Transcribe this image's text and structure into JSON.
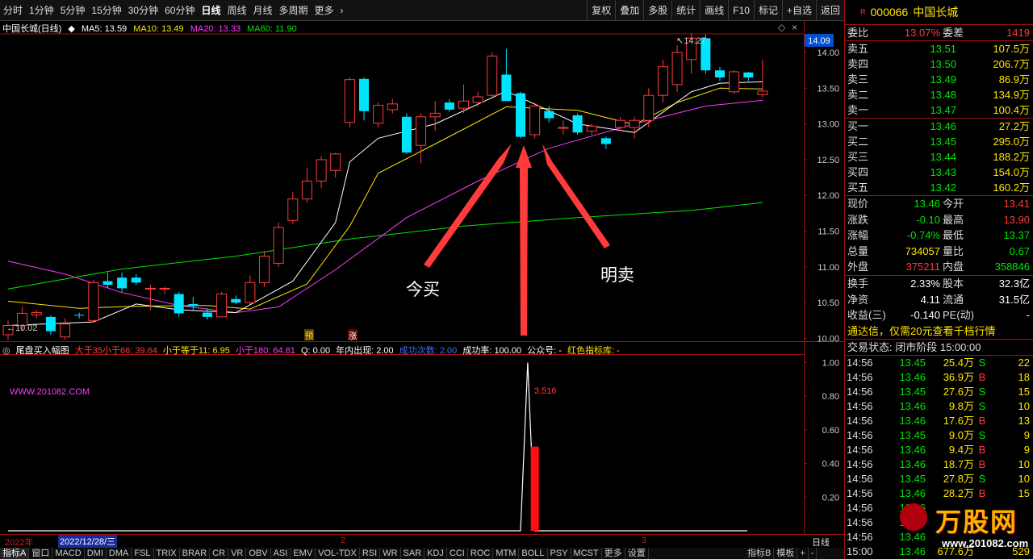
{
  "toolbar": {
    "periods": [
      "分时",
      "1分钟",
      "5分钟",
      "15分钟",
      "30分钟",
      "60分钟",
      "日线",
      "周线",
      "月线",
      "多周期",
      "更多"
    ],
    "active_period": "日线",
    "tools": [
      "复权",
      "叠加",
      "多股",
      "统计",
      "画线",
      "F10",
      "标记",
      "+自选",
      "返回"
    ]
  },
  "main_legend": {
    "name": "中国长城(日线)",
    "ma5": "MA5: 13.59",
    "ma10": "MA10: 13.49",
    "ma20": "MA20: 13.33",
    "ma60": "MA60: 11.90"
  },
  "indicator_legend": {
    "name": "尾盘买入幅图",
    "a": "大于35小于66: 39.64",
    "b": "小于等于11: 6.95",
    "c": "小于180: 64.81",
    "d": "Q: 0.00",
    "e": "年内出现: 2.00",
    "f": "成功次数: 2.00",
    "g": "成功率: 100.00",
    "h": "公众号: -",
    "i": "红色指标库: -"
  },
  "watermark_left": "WWW.201082.COM",
  "annotations": {
    "buy_text": "今买",
    "sell_text": "明卖",
    "max_label": "14.27",
    "min_label": "10.02",
    "value_label": "3.516",
    "marker1": "预",
    "marker2": "涨"
  },
  "price_axis": {
    "current": "14.09",
    "ticks": [
      "14.00",
      "13.50",
      "13.00",
      "12.50",
      "12.00",
      "11.50",
      "11.00",
      "10.50",
      "10.00"
    ]
  },
  "indicator_axis": {
    "ticks": [
      "1.00",
      "0.80",
      "0.60",
      "0.40",
      "0.20"
    ]
  },
  "time_axis": {
    "year": "2022年",
    "cursor_date": "2022/12/28/三",
    "month2": "2",
    "month3": "3",
    "period": "日线"
  },
  "bottom_tabs": [
    "指标A",
    "窗口",
    "MACD",
    "DMI",
    "DMA",
    "FSL",
    "TRIX",
    "BRAR",
    "CR",
    "VR",
    "OBV",
    "ASI",
    "EMV",
    "VOL-TDX",
    "RSI",
    "WR",
    "SAR",
    "KDJ",
    "CCI",
    "ROC",
    "MTM",
    "BOLL",
    "PSY",
    "MCST",
    "更多",
    "设置"
  ],
  "right_tabs": [
    "指标B",
    "模板",
    "+",
    "-"
  ],
  "quote": {
    "code": "000066",
    "name": "中国长城",
    "weibi_label": "委比",
    "weibi": "13.07%",
    "weicha_label": "委差",
    "weicha": "1419",
    "sell": [
      {
        "label": "卖五",
        "price": "13.51",
        "vol": "107.5万"
      },
      {
        "label": "卖四",
        "price": "13.50",
        "vol": "206.7万"
      },
      {
        "label": "卖三",
        "price": "13.49",
        "vol": "86.9万"
      },
      {
        "label": "卖二",
        "price": "13.48",
        "vol": "134.9万"
      },
      {
        "label": "卖一",
        "price": "13.47",
        "vol": "100.4万"
      }
    ],
    "buy": [
      {
        "label": "买一",
        "price": "13.46",
        "vol": "27.2万"
      },
      {
        "label": "买二",
        "price": "13.45",
        "vol": "295.0万"
      },
      {
        "label": "买三",
        "price": "13.44",
        "vol": "188.2万"
      },
      {
        "label": "买四",
        "price": "13.43",
        "vol": "154.0万"
      },
      {
        "label": "买五",
        "price": "13.42",
        "vol": "160.2万"
      }
    ],
    "stats": [
      {
        "l1": "现价",
        "v1": "13.46",
        "l2": "今开",
        "v2": "13.41",
        "c1": "dn",
        "c2": "up"
      },
      {
        "l1": "涨跌",
        "v1": "-0.10",
        "l2": "最高",
        "v2": "13.90",
        "c1": "dn",
        "c2": "up"
      },
      {
        "l1": "涨幅",
        "v1": "-0.74%",
        "l2": "最低",
        "v2": "13.37",
        "c1": "dn",
        "c2": "dn"
      },
      {
        "l1": "总量",
        "v1": "734057",
        "l2": "量比",
        "v2": "0.67",
        "c1": "yellow",
        "c2": "dn"
      },
      {
        "l1": "外盘",
        "v1": "375211",
        "l2": "内盘",
        "v2": "358846",
        "c1": "up",
        "c2": "dn"
      }
    ],
    "stats2": [
      {
        "l1": "换手",
        "v1": "2.33%",
        "l2": "股本",
        "v2": "32.3亿"
      },
      {
        "l1": "净资",
        "v1": "4.11",
        "l2": "流通",
        "v2": "31.5亿"
      },
      {
        "l1": "收益(三)",
        "v1": "-0.140",
        "l2": "PE(动)",
        "v2": "-"
      }
    ],
    "promo": "通达信，仅需20元查看千档行情",
    "trade_state": "交易状态: 闭市阶段 15:00:00",
    "ticks": [
      {
        "t": "14:56",
        "p": "13.45",
        "v": "25.4万",
        "s": "S",
        "n": "22"
      },
      {
        "t": "14:56",
        "p": "13.46",
        "v": "36.9万",
        "s": "B",
        "n": "18"
      },
      {
        "t": "14:56",
        "p": "13.45",
        "v": "27.6万",
        "s": "S",
        "n": "15"
      },
      {
        "t": "14:56",
        "p": "13.46",
        "v": "9.8万",
        "s": "S",
        "n": "10"
      },
      {
        "t": "14:56",
        "p": "13.46",
        "v": "17.6万",
        "s": "B",
        "n": "13"
      },
      {
        "t": "14:56",
        "p": "13.45",
        "v": "9.0万",
        "s": "S",
        "n": "9"
      },
      {
        "t": "14:56",
        "p": "13.46",
        "v": "9.4万",
        "s": "B",
        "n": "9"
      },
      {
        "t": "14:56",
        "p": "13.46",
        "v": "18.7万",
        "s": "B",
        "n": "10"
      },
      {
        "t": "14:56",
        "p": "13.45",
        "v": "27.8万",
        "s": "S",
        "n": "10"
      },
      {
        "t": "14:56",
        "p": "13.46",
        "v": "28.2万",
        "s": "B",
        "n": "15"
      },
      {
        "t": "14:56",
        "p": "13.46",
        "v": "",
        "s": "",
        "n": ""
      },
      {
        "t": "14:56",
        "p": "13.45",
        "v": "",
        "s": "",
        "n": ""
      },
      {
        "t": "14:56",
        "p": "13.46",
        "v": "",
        "s": "",
        "n": ""
      },
      {
        "t": "15:00",
        "p": "13.46",
        "v": "677.6万",
        "s": "",
        "n": "529"
      }
    ],
    "logo_text": "万股网",
    "logo_sub": "www.201082.com"
  },
  "colors": {
    "up": "#ff3b3b",
    "down": "#00e5ff",
    "ma5": "#ffffff",
    "ma10": "#ffe600",
    "ma20": "#ff3bff",
    "ma60": "#00e600",
    "frame": "#a01010"
  },
  "chart_data": {
    "type": "candlestick",
    "price_range": [
      9.96,
      14.26
    ],
    "candles": [
      {
        "o": 10.05,
        "h": 10.25,
        "l": 9.98,
        "c": 10.18
      },
      {
        "o": 10.18,
        "h": 10.45,
        "l": 10.1,
        "c": 10.35
      },
      {
        "o": 10.33,
        "h": 10.4,
        "l": 10.28,
        "c": 10.36
      },
      {
        "o": 10.3,
        "h": 10.32,
        "l": 10.05,
        "c": 10.1
      },
      {
        "o": 10.02,
        "h": 10.28,
        "l": 9.98,
        "c": 10.2
      },
      {
        "o": 10.33,
        "h": 10.36,
        "l": 10.28,
        "c": 10.32
      },
      {
        "o": 10.25,
        "h": 10.82,
        "l": 10.22,
        "c": 10.78
      },
      {
        "o": 10.8,
        "h": 10.92,
        "l": 10.7,
        "c": 10.75
      },
      {
        "o": 10.85,
        "h": 10.92,
        "l": 10.65,
        "c": 10.7
      },
      {
        "o": 10.85,
        "h": 10.9,
        "l": 10.75,
        "c": 10.78
      },
      {
        "o": 10.7,
        "h": 10.75,
        "l": 10.4,
        "c": 10.7
      },
      {
        "o": 10.7,
        "h": 10.72,
        "l": 10.62,
        "c": 10.7
      },
      {
        "o": 10.62,
        "h": 10.65,
        "l": 10.3,
        "c": 10.35
      },
      {
        "o": 10.48,
        "h": 10.58,
        "l": 10.38,
        "c": 10.45
      },
      {
        "o": 10.36,
        "h": 10.42,
        "l": 10.26,
        "c": 10.3
      },
      {
        "o": 10.3,
        "h": 10.65,
        "l": 10.3,
        "c": 10.62
      },
      {
        "o": 10.55,
        "h": 10.6,
        "l": 10.48,
        "c": 10.5
      },
      {
        "o": 10.5,
        "h": 10.88,
        "l": 10.48,
        "c": 10.78
      },
      {
        "o": 10.78,
        "h": 11.22,
        "l": 10.72,
        "c": 11.15
      },
      {
        "o": 11.05,
        "h": 11.62,
        "l": 11.0,
        "c": 11.55
      },
      {
        "o": 11.65,
        "h": 12.05,
        "l": 11.6,
        "c": 11.95
      },
      {
        "o": 11.95,
        "h": 12.38,
        "l": 11.9,
        "c": 12.2
      },
      {
        "o": 12.2,
        "h": 12.55,
        "l": 12.1,
        "c": 12.5
      },
      {
        "o": 12.35,
        "h": 12.6,
        "l": 12.25,
        "c": 12.58
      },
      {
        "o": 13.02,
        "h": 13.65,
        "l": 12.95,
        "c": 13.62
      },
      {
        "o": 13.63,
        "h": 13.65,
        "l": 13.05,
        "c": 13.18
      },
      {
        "o": 13.01,
        "h": 13.3,
        "l": 12.95,
        "c": 13.26
      },
      {
        "o": 13.2,
        "h": 13.35,
        "l": 13.15,
        "c": 13.28
      },
      {
        "o": 13.1,
        "h": 13.15,
        "l": 12.58,
        "c": 12.6
      },
      {
        "o": 12.7,
        "h": 13.15,
        "l": 12.45,
        "c": 13.1
      },
      {
        "o": 13.1,
        "h": 13.32,
        "l": 12.9,
        "c": 13.15
      },
      {
        "o": 13.3,
        "h": 13.35,
        "l": 13.17,
        "c": 13.2
      },
      {
        "o": 13.22,
        "h": 13.55,
        "l": 13.15,
        "c": 13.32
      },
      {
        "o": 13.3,
        "h": 13.45,
        "l": 13.25,
        "c": 13.38
      },
      {
        "o": 13.4,
        "h": 14.0,
        "l": 13.35,
        "c": 13.95
      },
      {
        "o": 13.69,
        "h": 14.05,
        "l": 13.35,
        "c": 13.32
      },
      {
        "o": 13.43,
        "h": 13.45,
        "l": 12.8,
        "c": 12.82
      },
      {
        "o": 12.85,
        "h": 13.3,
        "l": 12.8,
        "c": 13.25
      },
      {
        "o": 13.18,
        "h": 13.25,
        "l": 13.02,
        "c": 13.08
      },
      {
        "o": 12.95,
        "h": 13.05,
        "l": 12.85,
        "c": 12.95
      },
      {
        "o": 13.12,
        "h": 13.15,
        "l": 12.85,
        "c": 12.88
      },
      {
        "o": 12.9,
        "h": 13.0,
        "l": 12.85,
        "c": 12.97
      },
      {
        "o": 12.8,
        "h": 12.82,
        "l": 12.65,
        "c": 12.72
      },
      {
        "o": 12.95,
        "h": 13.1,
        "l": 12.9,
        "c": 13.05
      },
      {
        "o": 12.95,
        "h": 13.1,
        "l": 12.8,
        "c": 13.05
      },
      {
        "o": 13.05,
        "h": 13.5,
        "l": 12.95,
        "c": 13.4
      },
      {
        "o": 13.4,
        "h": 13.9,
        "l": 13.3,
        "c": 13.8
      },
      {
        "o": 13.55,
        "h": 14.1,
        "l": 13.45,
        "c": 14.0
      },
      {
        "o": 13.9,
        "h": 14.27,
        "l": 13.7,
        "c": 14.2
      },
      {
        "o": 14.2,
        "h": 14.25,
        "l": 13.7,
        "c": 13.75
      },
      {
        "o": 13.75,
        "h": 13.8,
        "l": 13.6,
        "c": 13.65
      },
      {
        "o": 13.45,
        "h": 13.75,
        "l": 13.42,
        "c": 13.73
      },
      {
        "o": 13.72,
        "h": 13.73,
        "l": 13.6,
        "c": 13.65
      },
      {
        "o": 13.41,
        "h": 13.9,
        "l": 13.37,
        "c": 13.46
      }
    ],
    "ma5_pts": [
      [
        0,
        10.18
      ],
      [
        6,
        10.23
      ],
      [
        9,
        10.48
      ],
      [
        12,
        10.4
      ],
      [
        16,
        10.36
      ],
      [
        20,
        10.8
      ],
      [
        23,
        11.62
      ],
      [
        24,
        12.47
      ],
      [
        26,
        12.8
      ],
      [
        30,
        13.0
      ],
      [
        35,
        13.46
      ],
      [
        40,
        13.0
      ],
      [
        44,
        12.88
      ],
      [
        48,
        13.45
      ],
      [
        50,
        13.57
      ],
      [
        53,
        13.59
      ]
    ],
    "ma10_pts": [
      [
        0,
        10.52
      ],
      [
        5,
        10.42
      ],
      [
        9,
        10.45
      ],
      [
        14,
        10.46
      ],
      [
        17,
        10.41
      ],
      [
        21,
        10.76
      ],
      [
        24,
        11.57
      ],
      [
        26,
        12.31
      ],
      [
        30,
        12.72
      ],
      [
        35,
        13.24
      ],
      [
        40,
        13.19
      ],
      [
        44,
        12.99
      ],
      [
        47,
        13.3
      ],
      [
        50,
        13.5
      ],
      [
        53,
        13.49
      ]
    ],
    "ma20_pts": [
      [
        0,
        11.08
      ],
      [
        4,
        10.9
      ],
      [
        8,
        10.64
      ],
      [
        12,
        10.46
      ],
      [
        16,
        10.36
      ],
      [
        19,
        10.44
      ],
      [
        23,
        10.96
      ],
      [
        28,
        11.69
      ],
      [
        33,
        12.2
      ],
      [
        38,
        12.66
      ],
      [
        44,
        13.0
      ],
      [
        49,
        13.25
      ],
      [
        53,
        13.33
      ]
    ],
    "ma60_pts": [
      [
        0,
        10.69
      ],
      [
        8,
        10.97
      ],
      [
        16,
        11.15
      ],
      [
        24,
        11.39
      ],
      [
        32,
        11.57
      ],
      [
        40,
        11.69
      ],
      [
        48,
        11.79
      ],
      [
        53,
        11.9
      ]
    ],
    "signal": {
      "x": [
        36,
        36.5,
        37,
        37.5
      ],
      "y": [
        0.0,
        1.0,
        0.0,
        0.0
      ],
      "bar_index": 37,
      "bar_value": 0.5
    },
    "indicator_range": [
      0,
      1.05
    ]
  }
}
